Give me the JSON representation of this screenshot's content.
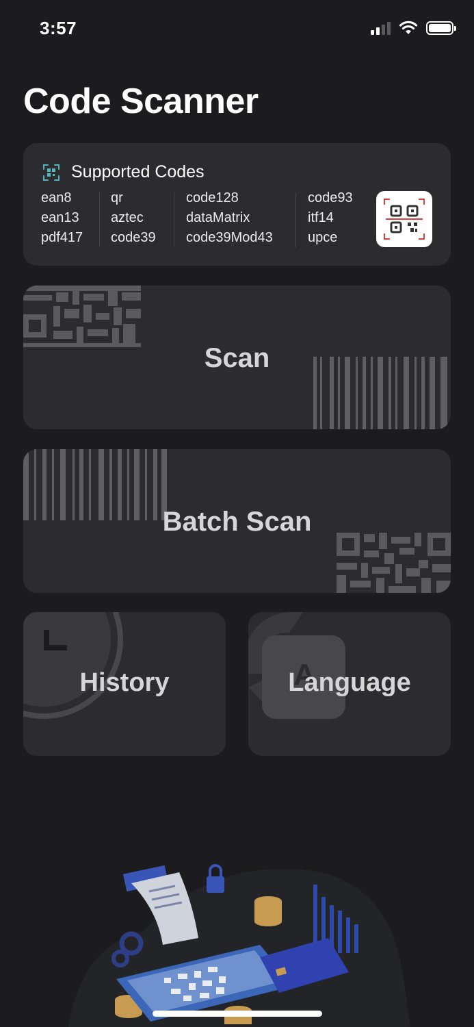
{
  "status_bar": {
    "time": "3:57"
  },
  "page": {
    "title": "Code Scanner"
  },
  "supported": {
    "title": "Supported Codes",
    "columns": [
      [
        "ean8",
        "ean13",
        "pdf417"
      ],
      [
        "qr",
        "aztec",
        "code39"
      ],
      [
        "code128",
        "dataMatrix",
        "code39Mod43"
      ],
      [
        "code93",
        "itf14",
        "upce"
      ]
    ]
  },
  "actions": {
    "scan": "Scan",
    "batch_scan": "Batch Scan",
    "history": "History",
    "language": "Language"
  },
  "icons": {
    "supported": "qr-scan-icon",
    "qr_thumb": "qr-code-icon",
    "history": "clock-icon",
    "language": "translate-icon"
  },
  "colors": {
    "background": "#1c1c1e",
    "card": "#2c2c2e",
    "accent_teal": "#4fb8c2",
    "scan_red": "#e23b3b",
    "illustration_blue": "#3a55b8"
  }
}
